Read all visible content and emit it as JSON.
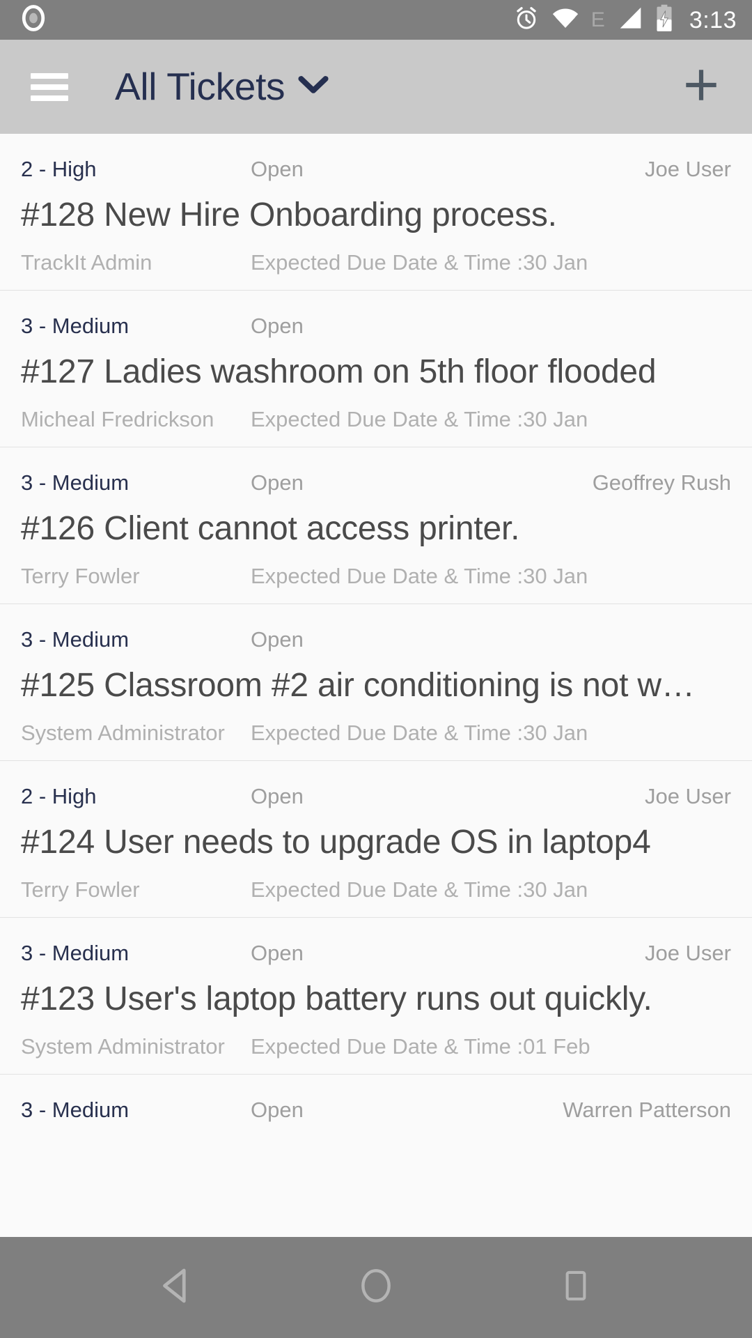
{
  "status_bar": {
    "time": "3:13",
    "network_label": "E",
    "icons": [
      "record-icon",
      "alarm-icon",
      "wifi-icon",
      "edge-network-icon",
      "cellular-signal-icon",
      "battery-charging-icon"
    ],
    "background": "#7f7f7f",
    "foreground": "#ffffff"
  },
  "app_bar": {
    "title": "All Tickets",
    "menu_icon": "hamburger-menu-icon",
    "dropdown_icon": "chevron-down-icon",
    "add_icon": "plus-icon",
    "background": "#c9c9c9",
    "title_color": "#252f50"
  },
  "list": {
    "due_label_prefix": "Expected Due Date & Time :",
    "tickets": [
      {
        "priority": "2 - High",
        "status": "Open",
        "assignee": "Joe User",
        "title": "#128 New Hire Onboarding process.",
        "requester": "TrackIt Admin",
        "due": "Expected Due Date & Time :30 Jan"
      },
      {
        "priority": "3 - Medium",
        "status": "Open",
        "assignee": "",
        "title": "#127 Ladies washroom on 5th floor flooded",
        "requester": "Micheal Fredrickson",
        "due": "Expected Due Date & Time :30 Jan"
      },
      {
        "priority": "3 - Medium",
        "status": "Open",
        "assignee": "Geoffrey Rush",
        "title": "#126 Client cannot access printer.",
        "requester": "Terry Fowler",
        "due": "Expected Due Date & Time :30 Jan"
      },
      {
        "priority": "3 - Medium",
        "status": "Open",
        "assignee": "",
        "title": "#125 Classroom #2 air conditioning is not w…",
        "requester": "System Administrator",
        "due": "Expected Due Date & Time :30 Jan"
      },
      {
        "priority": "2 - High",
        "status": "Open",
        "assignee": "Joe User",
        "title": "#124 User needs to upgrade OS in laptop4",
        "requester": "Terry Fowler",
        "due": "Expected Due Date & Time :30 Jan"
      },
      {
        "priority": "3 - Medium",
        "status": "Open",
        "assignee": "Joe User",
        "title": "#123 User's laptop battery runs out quickly.",
        "requester": "System Administrator",
        "due": "Expected Due Date & Time :01 Feb"
      },
      {
        "priority": "3 - Medium",
        "status": "Open",
        "assignee": "Warren Patterson",
        "title": "",
        "requester": "",
        "due": ""
      }
    ]
  },
  "nav_bar": {
    "back_icon": "back-triangle-icon",
    "home_icon": "home-circle-icon",
    "recents_icon": "recents-square-icon",
    "background": "#7f7f7f"
  }
}
